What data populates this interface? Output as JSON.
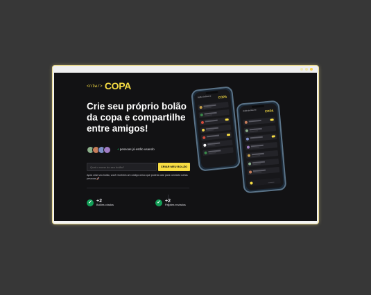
{
  "window": {
    "dot_colors": [
      "#f2e9b0",
      "#f1e7a8",
      "#f7cf4a"
    ]
  },
  "logo": {
    "tag": "<nlw/>",
    "brand": "COPA"
  },
  "hero": {
    "headline": "Crie seu próprio bolão da copa e compartilhe entre amigos!",
    "people_plus": "+",
    "people_text": "pessoas já estão usando",
    "avatar_colors": [
      "#8bb08a",
      "#c77d5a",
      "#7d8fc7",
      "#a07cc4"
    ]
  },
  "form": {
    "input_placeholder": "Qual o nome do seu bolão?",
    "cta_label": "CRIAR MEU BOLÃO",
    "hint": "Após criar seu bolão, você receberá um código único que poderá usar para convidar outras pessoas 🚀"
  },
  "stats": [
    {
      "value": "+2",
      "label": "Bolões criados"
    },
    {
      "value": "+2",
      "label": "Palpites enviados"
    }
  ],
  "phones": {
    "screen_title": "Bolão de Bourne",
    "screen_copa": "COPA"
  },
  "colors": {
    "accent": "#f7dd43",
    "success": "#129e57",
    "background": "#121214"
  }
}
